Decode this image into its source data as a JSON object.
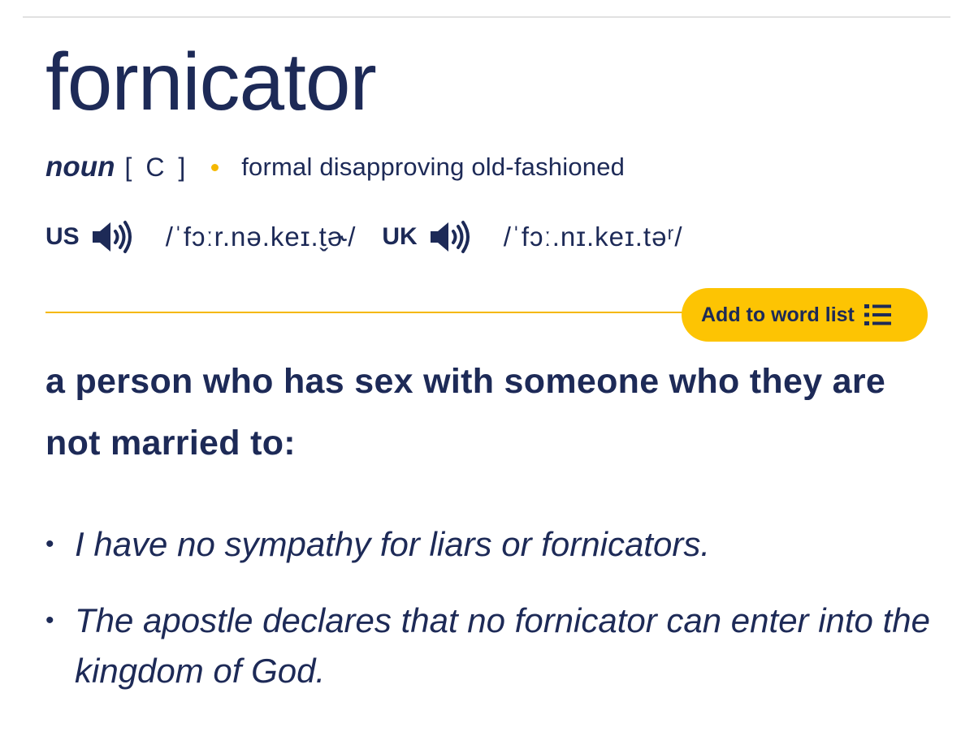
{
  "entry": {
    "headword": "fornicator",
    "part_of_speech": "noun",
    "grammar_code": "[ C ]",
    "usage_labels": "formal disapproving old-fashioned",
    "pronunciations": [
      {
        "region": "US",
        "ipa": "/ˈfɔːr.nə.keɪ.t̬ɚ/",
        "icon": "speaker-icon"
      },
      {
        "region": "UK",
        "ipa": "/ˈfɔː.nɪ.keɪ.təʳ/",
        "icon": "speaker-icon"
      }
    ],
    "add_to_word_list": {
      "label": "Add to word list",
      "icon": "list-icon"
    },
    "definition": "a person who has sex with someone who they are not married to:",
    "examples": [
      "I have no sympathy for liars or fornicators.",
      "The apostle declares that no fornicator can enter into the kingdom of God."
    ]
  },
  "colors": {
    "text": "#1d2a57",
    "accent": "#fdc403",
    "rule": "#f5b800",
    "top_rule": "#e1e1e1"
  }
}
